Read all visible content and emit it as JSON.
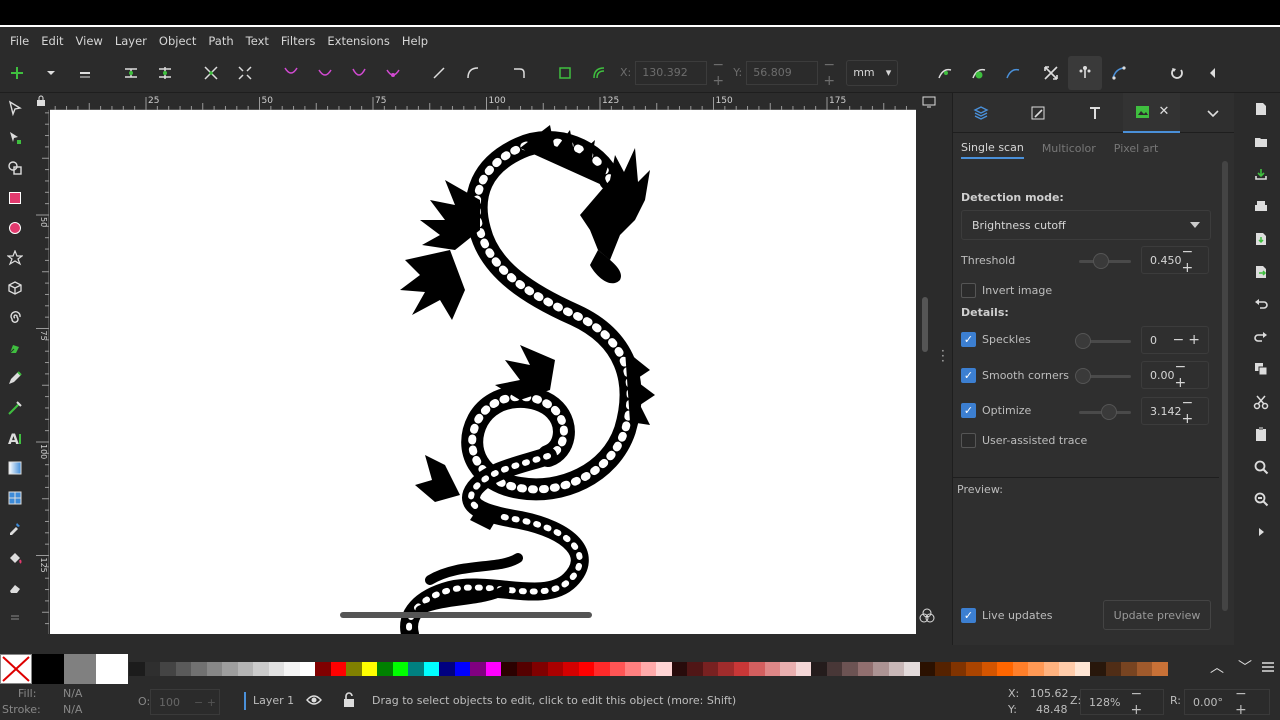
{
  "menu": [
    "File",
    "Edit",
    "View",
    "Layer",
    "Object",
    "Path",
    "Text",
    "Filters",
    "Extensions",
    "Help"
  ],
  "toolbar": {
    "x_label": "X:",
    "x_value": "130.392",
    "y_label": "Y:",
    "y_value": "56.809",
    "unit": "mm"
  },
  "ruler": {
    "top_ticks": [
      "25",
      "50",
      "75",
      "100",
      "125",
      "150",
      "175"
    ],
    "left_ticks": [
      "50",
      "75",
      "100",
      "125"
    ]
  },
  "dock": {
    "subtabs": [
      "Single scan",
      "Multicolor",
      "Pixel art"
    ],
    "detection_mode_label": "Detection mode:",
    "detection_mode_value": "Brightness cutoff",
    "threshold_label": "Threshold",
    "threshold_value": "0.450",
    "invert_label": "Invert image",
    "details_label": "Details:",
    "speckles_label": "Speckles",
    "speckles_value": "0",
    "smooth_label": "Smooth corners",
    "smooth_value": "0.00",
    "optimize_label": "Optimize",
    "optimize_value": "3.142",
    "user_assisted_label": "User-assisted trace",
    "preview_label": "Preview:",
    "live_updates_label": "Live updates",
    "update_preview_label": "Update preview"
  },
  "palette_colors": [
    "#1c1c1c",
    "#2f2f2f",
    "#444444",
    "#5a5a5a",
    "#717171",
    "#878787",
    "#9e9e9e",
    "#b4b4b4",
    "#cbcbcb",
    "#e1e1e1",
    "#f5f5f5",
    "#ffffff",
    "#800000",
    "#ff0000",
    "#808000",
    "#ffff00",
    "#008000",
    "#00ff00",
    "#008080",
    "#00ffff",
    "#000080",
    "#0000ff",
    "#800080",
    "#ff00ff",
    "#2b0000",
    "#550000",
    "#800000",
    "#aa0000",
    "#d40000",
    "#ff0000",
    "#ff2a2a",
    "#ff5555",
    "#ff8080",
    "#ffaaaa",
    "#ffd5d5",
    "#280b0b",
    "#501616",
    "#782121",
    "#a02c2c",
    "#c83737",
    "#d35f5f",
    "#de8787",
    "#e9afaf",
    "#f4d7d7",
    "#241c1c",
    "#483737",
    "#6c5353",
    "#916f6f",
    "#ac9393",
    "#c8b7b7",
    "#e3dbdb",
    "#2b1100",
    "#552200",
    "#803300",
    "#aa4400",
    "#d45500",
    "#ff6600",
    "#ff7f2a",
    "#ff9955",
    "#ffb380",
    "#ffccaa",
    "#ffe6d5",
    "#28170b",
    "#502d16",
    "#784421",
    "#a05a2c",
    "#c87137"
  ],
  "status": {
    "fill_label": "Fill:",
    "fill_value": "N/A",
    "stroke_label": "Stroke:",
    "stroke_value": "N/A",
    "opacity_label": "O:",
    "opacity_value": "100",
    "layer": "Layer 1",
    "message": "Drag to select objects to edit, click to edit this object (more: Shift)",
    "x_label": "X:",
    "x_value": "105.62",
    "y_label": "Y:",
    "y_value": "48.48",
    "zoom_label": "Z:",
    "zoom_value": "128%",
    "rotate_label": "R:",
    "rotate_value": "0.00°"
  }
}
